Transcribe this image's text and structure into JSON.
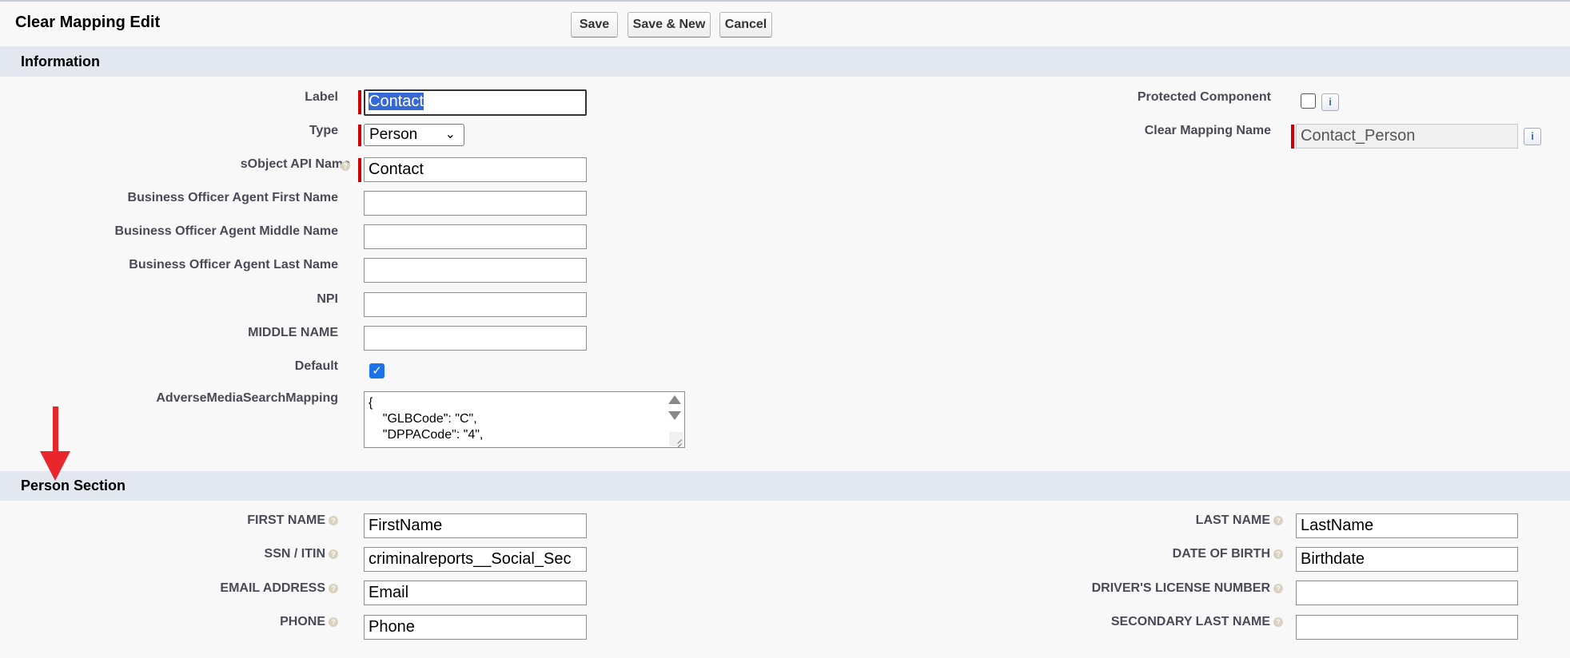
{
  "page": {
    "title": "Clear Mapping Edit"
  },
  "toolbar": {
    "save_label": "Save",
    "save_new_label": "Save & New",
    "cancel_label": "Cancel"
  },
  "information": {
    "title": "Information",
    "label_label": "Label",
    "label_value": "Contact",
    "type_label": "Type",
    "type_value": "Person",
    "sobject_label": "sObject API Name",
    "sobject_value": "Contact",
    "bo_first_label": "Business Officer Agent First Name",
    "bo_first_value": "",
    "bo_middle_label": "Business Officer Agent Middle Name",
    "bo_middle_value": "",
    "bo_last_label": "Business Officer Agent Last Name",
    "bo_last_value": "",
    "npi_label": "NPI",
    "npi_value": "",
    "middle_name_label": "MIDDLE NAME",
    "middle_name_value": "",
    "default_label": "Default",
    "default_checked": true,
    "adverse_label": "AdverseMediaSearchMapping",
    "adverse_lines": [
      "{",
      "    \"GLBCode\": \"C\",",
      "    \"DPPACode\": \"4\","
    ],
    "protected_label": "Protected Component",
    "protected_checked": false,
    "mapping_name_label": "Clear Mapping Name",
    "mapping_name_value": "Contact_Person"
  },
  "person": {
    "title": "Person Section",
    "first_name_label": "FIRST NAME",
    "first_name_value": "FirstName",
    "ssn_label": "SSN / ITIN",
    "ssn_value": "criminalreports__Social_Sec",
    "email_label": "EMAIL ADDRESS",
    "email_value": "Email",
    "phone_label": "PHONE",
    "phone_value": "Phone",
    "last_name_label": "LAST NAME",
    "last_name_value": "LastName",
    "dob_label": "DATE OF BIRTH",
    "dob_value": "Birthdate",
    "dl_label": "DRIVER'S LICENSE NUMBER",
    "dl_value": "",
    "secondary_last_label": "SECONDARY LAST NAME",
    "secondary_last_value": ""
  },
  "icons": {
    "help": "help-icon",
    "info": "info-icon",
    "chevron": "chevron-down-icon",
    "check": "checkmark-icon"
  },
  "colors": {
    "required": "#cc0000",
    "section_bg": "#e3e7ef",
    "checkbox_checked": "#1a73e8",
    "selection": "#3669d6",
    "annotation_arrow": "#e8262b"
  }
}
